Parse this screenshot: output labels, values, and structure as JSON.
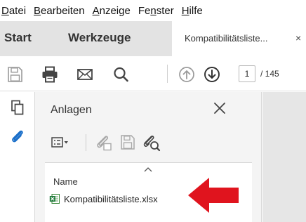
{
  "menubar": {
    "items": [
      {
        "pre": "",
        "u": "D",
        "post": "atei"
      },
      {
        "pre": "",
        "u": "B",
        "post": "earbeiten"
      },
      {
        "pre": "",
        "u": "A",
        "post": "nzeige"
      },
      {
        "pre": "Fe",
        "u": "n",
        "post": "ster"
      },
      {
        "pre": "",
        "u": "H",
        "post": "ilfe"
      }
    ]
  },
  "tabs": {
    "start": "Start",
    "tools": "Werkzeuge",
    "document": "Kompatibilitätsliste...",
    "close": "×"
  },
  "toolbar": {
    "icons": [
      "save-icon",
      "print-icon",
      "email-icon",
      "search-icon",
      "page-up-icon",
      "page-down-icon"
    ],
    "page_current": "1",
    "page_total": "/ 145"
  },
  "rail": {
    "icons": [
      "page-thumbnails-icon",
      "attachments-icon"
    ]
  },
  "attachments_panel": {
    "title": "Anlagen",
    "tools": [
      "options-menu-icon",
      "add-attachment-icon",
      "save-attachment-icon",
      "search-attachment-icon"
    ],
    "column_header": "Name",
    "files": [
      {
        "name": "Kompatibilitätsliste.xlsx",
        "icon": "excel-file-icon"
      }
    ]
  },
  "annotation": {
    "arrow_color": "#e0141e"
  }
}
